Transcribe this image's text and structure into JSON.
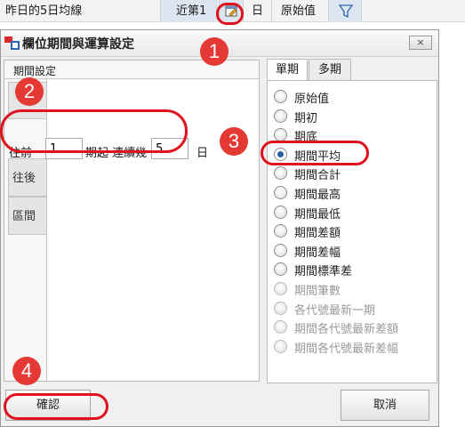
{
  "toolbar": {
    "title": "昨日的5日均線",
    "recent_label": "近第1",
    "calendar_icon": "calendar-edit-icon",
    "day_label": "日",
    "original_label": "原始值",
    "filter_icon": "funnel-icon"
  },
  "dialog": {
    "title": "欄位期間與運算設定",
    "close_label": "×"
  },
  "period_group": {
    "label": "期間設定",
    "tabs": [
      "往前",
      "往後",
      "區間"
    ],
    "before_row": {
      "prefix": "往前",
      "periods_value": "1",
      "middle": "期起 連續幾",
      "count_value": "5",
      "suffix": "日"
    }
  },
  "calc_tabs": [
    "單期",
    "多期"
  ],
  "calc_options": [
    {
      "label": "原始值",
      "checked": false,
      "enabled": true
    },
    {
      "label": "期初",
      "checked": false,
      "enabled": true
    },
    {
      "label": "期底",
      "checked": false,
      "enabled": true
    },
    {
      "label": "期間平均",
      "checked": true,
      "enabled": true
    },
    {
      "label": "期間合計",
      "checked": false,
      "enabled": true
    },
    {
      "label": "期間最高",
      "checked": false,
      "enabled": true
    },
    {
      "label": "期間最低",
      "checked": false,
      "enabled": true
    },
    {
      "label": "期間差額",
      "checked": false,
      "enabled": true
    },
    {
      "label": "期間差幅",
      "checked": false,
      "enabled": true
    },
    {
      "label": "期間標準差",
      "checked": false,
      "enabled": true
    },
    {
      "label": "期間筆數",
      "checked": false,
      "enabled": false
    },
    {
      "label": "各代號最新一期",
      "checked": false,
      "enabled": false
    },
    {
      "label": "期間各代號最新差額",
      "checked": false,
      "enabled": false
    },
    {
      "label": "期間各代號最新差幅",
      "checked": false,
      "enabled": false
    }
  ],
  "buttons": {
    "ok": "確認",
    "cancel": "取消"
  },
  "markers": [
    "1",
    "2",
    "3",
    "4"
  ],
  "colors": {
    "annotation": "#e53935",
    "radio_checked": "#2a5fa8"
  }
}
